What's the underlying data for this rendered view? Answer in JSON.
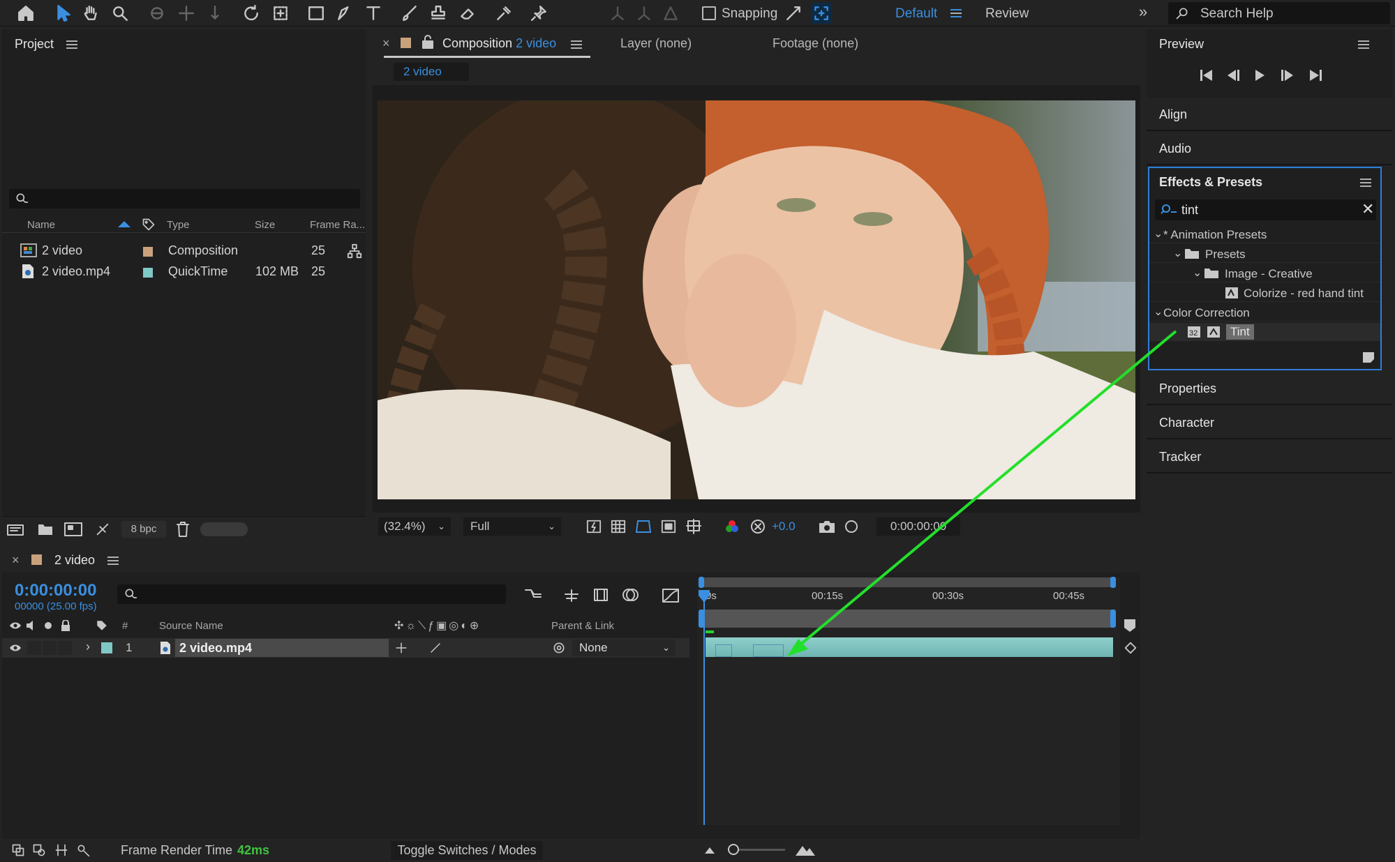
{
  "toolbar": {
    "snapping_label": "Snapping",
    "workspace_default": "Default",
    "workspace_review": "Review",
    "search_help": "Search Help"
  },
  "project": {
    "title": "Project",
    "columns": [
      "Name",
      "Type",
      "Size",
      "Frame Ra..."
    ],
    "items": [
      {
        "name": "2 video",
        "type": "Composition",
        "size": "",
        "frame_rate": "25",
        "color": "#c9a27d"
      },
      {
        "name": "2 video.mp4",
        "type": "QuickTime",
        "size": "102 MB",
        "frame_rate": "25",
        "color": "#7fc8c6"
      }
    ],
    "bpc": "8 bpc"
  },
  "viewer": {
    "tab_composition": "Composition",
    "tab_composition_name": "2 video",
    "tab_layer": "Layer (none)",
    "tab_footage": "Footage (none)",
    "sub_tab": "2 video",
    "zoom": "(32.4%)",
    "resolution": "Full",
    "exposure": "+0.0",
    "timecode": "0:00:00:00"
  },
  "right": {
    "preview": "Preview",
    "align": "Align",
    "audio": "Audio",
    "effects_title": "Effects & Presets",
    "search_value": "tint",
    "tree": {
      "animation_presets": "* Animation Presets",
      "presets": "Presets",
      "image_creative": "Image - Creative",
      "colorize": "Colorize - red hand tint",
      "color_correction": "Color Correction",
      "tint": "Tint"
    },
    "properties": "Properties",
    "character": "Character",
    "tracker": "Tracker"
  },
  "timeline": {
    "comp_name": "2 video",
    "timecode": "0:00:00:00",
    "fps": "00000 (25.00 fps)",
    "col_hash": "#",
    "col_source": "Source Name",
    "col_parent": "Parent & Link",
    "layer_num": "1",
    "layer_name": "2 video.mp4",
    "parent_value": "None",
    "ruler": [
      "0s",
      "00:15s",
      "00:30s",
      "00:45s"
    ],
    "frame_render_label": "Frame Render Time",
    "frame_render_value": "42ms",
    "toggle_label": "Toggle Switches / Modes"
  },
  "colors": {
    "accent": "#3a8fe0",
    "arrow": "#22e02a",
    "teal": "#7fc8c6"
  }
}
